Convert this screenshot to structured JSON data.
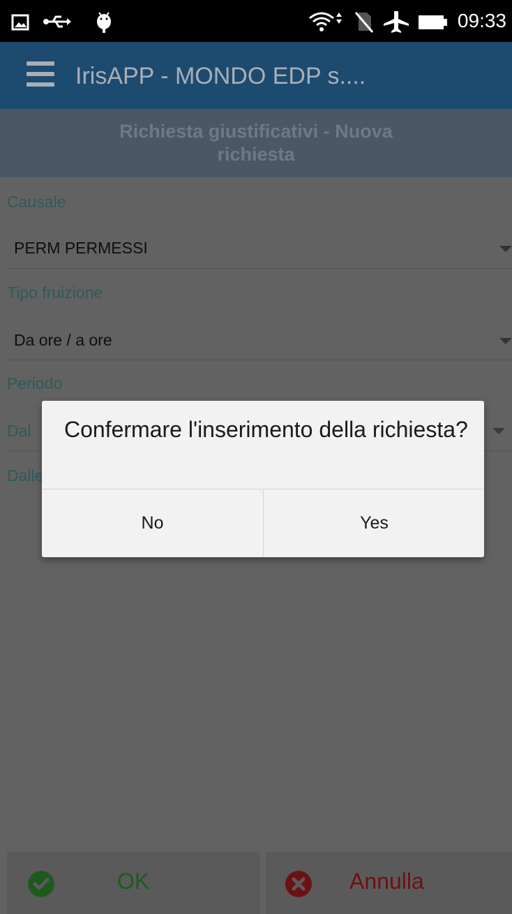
{
  "status_bar": {
    "time": "09:33",
    "icons": [
      "image-icon",
      "usb-icon",
      "android-debug-icon",
      "wifi-icon",
      "no-sim-icon",
      "airplane-icon",
      "battery-icon"
    ]
  },
  "app_bar": {
    "title": "IrisAPP - MONDO EDP s....",
    "menu_icon": "hamburger-menu-icon"
  },
  "page_header": {
    "title": "Richiesta giustificativi - Nuova richiesta"
  },
  "form": {
    "causale": {
      "label": "Causale",
      "value": "PERM  PERMESSI"
    },
    "tipo_fruizione": {
      "label": "Tipo fruizione",
      "value": "Da ore / a ore"
    },
    "periodo": {
      "label": "Periodo"
    },
    "dal": {
      "label": "Dal"
    },
    "dalle": {
      "label": "Dalle"
    }
  },
  "dialog": {
    "message": "Confermare l'inserimento della richiesta?",
    "no_label": "No",
    "yes_label": "Yes"
  },
  "bottom_bar": {
    "ok_label": "OK",
    "cancel_label": "Annulla",
    "ok_icon": "check-circle-icon",
    "cancel_icon": "x-circle-icon",
    "colors": {
      "ok": "#1e5a1e",
      "cancel": "#6e1111"
    }
  }
}
